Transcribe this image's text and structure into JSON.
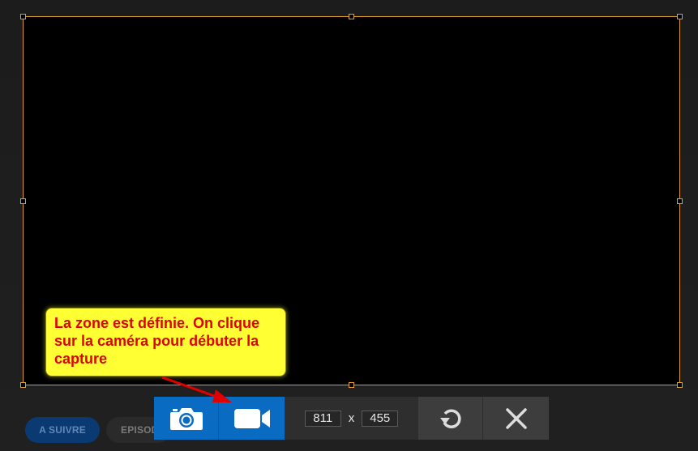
{
  "background": {
    "pills": {
      "follow": "A SUIVRE",
      "episodes": "EPISOD"
    }
  },
  "toolbar": {
    "photo_icon": "camera-icon",
    "video_icon": "video-camera-icon",
    "width": "811",
    "separator": "x",
    "height": "455",
    "redo_icon": "redo-icon",
    "close_icon": "close-icon"
  },
  "annotation": {
    "text": "La zone est définie. On clique sur la caméra pour débuter la capture"
  },
  "colors": {
    "accent": "#0a6bc2",
    "selection_border": "#d89a2a",
    "callout_bg": "#ffff33",
    "callout_text": "#e00000"
  }
}
